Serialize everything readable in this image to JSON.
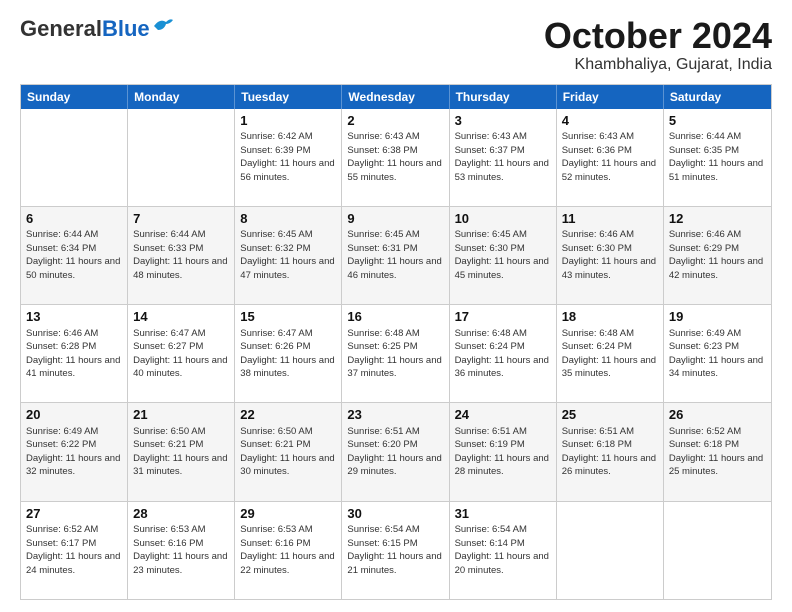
{
  "header": {
    "logo_general": "General",
    "logo_blue": "Blue",
    "month_title": "October 2024",
    "subtitle": "Khambhaliya, Gujarat, India"
  },
  "weekdays": [
    "Sunday",
    "Monday",
    "Tuesday",
    "Wednesday",
    "Thursday",
    "Friday",
    "Saturday"
  ],
  "rows": [
    {
      "cells": [
        {
          "day": "",
          "info": "",
          "shaded": false
        },
        {
          "day": "",
          "info": "",
          "shaded": false
        },
        {
          "day": "1",
          "info": "Sunrise: 6:42 AM\nSunset: 6:39 PM\nDaylight: 11 hours and 56 minutes.",
          "shaded": false
        },
        {
          "day": "2",
          "info": "Sunrise: 6:43 AM\nSunset: 6:38 PM\nDaylight: 11 hours and 55 minutes.",
          "shaded": false
        },
        {
          "day": "3",
          "info": "Sunrise: 6:43 AM\nSunset: 6:37 PM\nDaylight: 11 hours and 53 minutes.",
          "shaded": false
        },
        {
          "day": "4",
          "info": "Sunrise: 6:43 AM\nSunset: 6:36 PM\nDaylight: 11 hours and 52 minutes.",
          "shaded": false
        },
        {
          "day": "5",
          "info": "Sunrise: 6:44 AM\nSunset: 6:35 PM\nDaylight: 11 hours and 51 minutes.",
          "shaded": false
        }
      ]
    },
    {
      "cells": [
        {
          "day": "6",
          "info": "Sunrise: 6:44 AM\nSunset: 6:34 PM\nDaylight: 11 hours and 50 minutes.",
          "shaded": true
        },
        {
          "day": "7",
          "info": "Sunrise: 6:44 AM\nSunset: 6:33 PM\nDaylight: 11 hours and 48 minutes.",
          "shaded": true
        },
        {
          "day": "8",
          "info": "Sunrise: 6:45 AM\nSunset: 6:32 PM\nDaylight: 11 hours and 47 minutes.",
          "shaded": true
        },
        {
          "day": "9",
          "info": "Sunrise: 6:45 AM\nSunset: 6:31 PM\nDaylight: 11 hours and 46 minutes.",
          "shaded": true
        },
        {
          "day": "10",
          "info": "Sunrise: 6:45 AM\nSunset: 6:30 PM\nDaylight: 11 hours and 45 minutes.",
          "shaded": true
        },
        {
          "day": "11",
          "info": "Sunrise: 6:46 AM\nSunset: 6:30 PM\nDaylight: 11 hours and 43 minutes.",
          "shaded": true
        },
        {
          "day": "12",
          "info": "Sunrise: 6:46 AM\nSunset: 6:29 PM\nDaylight: 11 hours and 42 minutes.",
          "shaded": true
        }
      ]
    },
    {
      "cells": [
        {
          "day": "13",
          "info": "Sunrise: 6:46 AM\nSunset: 6:28 PM\nDaylight: 11 hours and 41 minutes.",
          "shaded": false
        },
        {
          "day": "14",
          "info": "Sunrise: 6:47 AM\nSunset: 6:27 PM\nDaylight: 11 hours and 40 minutes.",
          "shaded": false
        },
        {
          "day": "15",
          "info": "Sunrise: 6:47 AM\nSunset: 6:26 PM\nDaylight: 11 hours and 38 minutes.",
          "shaded": false
        },
        {
          "day": "16",
          "info": "Sunrise: 6:48 AM\nSunset: 6:25 PM\nDaylight: 11 hours and 37 minutes.",
          "shaded": false
        },
        {
          "day": "17",
          "info": "Sunrise: 6:48 AM\nSunset: 6:24 PM\nDaylight: 11 hours and 36 minutes.",
          "shaded": false
        },
        {
          "day": "18",
          "info": "Sunrise: 6:48 AM\nSunset: 6:24 PM\nDaylight: 11 hours and 35 minutes.",
          "shaded": false
        },
        {
          "day": "19",
          "info": "Sunrise: 6:49 AM\nSunset: 6:23 PM\nDaylight: 11 hours and 34 minutes.",
          "shaded": false
        }
      ]
    },
    {
      "cells": [
        {
          "day": "20",
          "info": "Sunrise: 6:49 AM\nSunset: 6:22 PM\nDaylight: 11 hours and 32 minutes.",
          "shaded": true
        },
        {
          "day": "21",
          "info": "Sunrise: 6:50 AM\nSunset: 6:21 PM\nDaylight: 11 hours and 31 minutes.",
          "shaded": true
        },
        {
          "day": "22",
          "info": "Sunrise: 6:50 AM\nSunset: 6:21 PM\nDaylight: 11 hours and 30 minutes.",
          "shaded": true
        },
        {
          "day": "23",
          "info": "Sunrise: 6:51 AM\nSunset: 6:20 PM\nDaylight: 11 hours and 29 minutes.",
          "shaded": true
        },
        {
          "day": "24",
          "info": "Sunrise: 6:51 AM\nSunset: 6:19 PM\nDaylight: 11 hours and 28 minutes.",
          "shaded": true
        },
        {
          "day": "25",
          "info": "Sunrise: 6:51 AM\nSunset: 6:18 PM\nDaylight: 11 hours and 26 minutes.",
          "shaded": true
        },
        {
          "day": "26",
          "info": "Sunrise: 6:52 AM\nSunset: 6:18 PM\nDaylight: 11 hours and 25 minutes.",
          "shaded": true
        }
      ]
    },
    {
      "cells": [
        {
          "day": "27",
          "info": "Sunrise: 6:52 AM\nSunset: 6:17 PM\nDaylight: 11 hours and 24 minutes.",
          "shaded": false
        },
        {
          "day": "28",
          "info": "Sunrise: 6:53 AM\nSunset: 6:16 PM\nDaylight: 11 hours and 23 minutes.",
          "shaded": false
        },
        {
          "day": "29",
          "info": "Sunrise: 6:53 AM\nSunset: 6:16 PM\nDaylight: 11 hours and 22 minutes.",
          "shaded": false
        },
        {
          "day": "30",
          "info": "Sunrise: 6:54 AM\nSunset: 6:15 PM\nDaylight: 11 hours and 21 minutes.",
          "shaded": false
        },
        {
          "day": "31",
          "info": "Sunrise: 6:54 AM\nSunset: 6:14 PM\nDaylight: 11 hours and 20 minutes.",
          "shaded": false
        },
        {
          "day": "",
          "info": "",
          "shaded": false
        },
        {
          "day": "",
          "info": "",
          "shaded": false
        }
      ]
    }
  ]
}
